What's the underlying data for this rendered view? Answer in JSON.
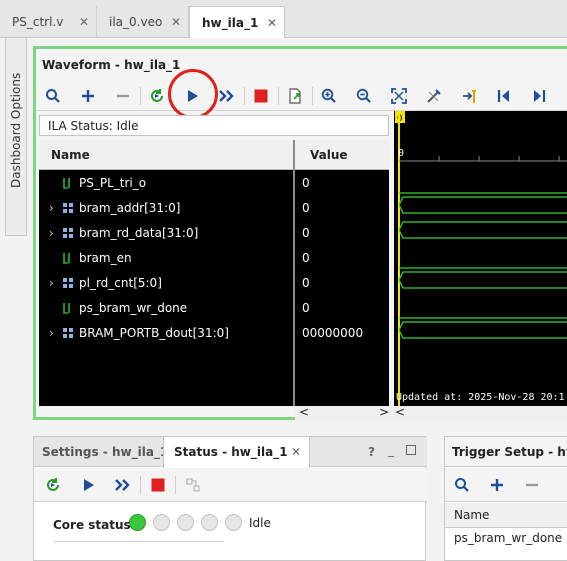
{
  "tabs": [
    {
      "label": "PS_ctrl.v",
      "active": false
    },
    {
      "label": "ila_0.veo",
      "active": false
    },
    {
      "label": "hw_ila_1",
      "active": true
    }
  ],
  "side_label": "Dashboard Options",
  "waveform": {
    "title": "Waveform - hw_ila_1",
    "ila_status": "ILA Status:  Idle",
    "col_name": "Name",
    "col_value": "Value",
    "signals": [
      {
        "name": "PS_PL_tri_o",
        "value": "0",
        "expandable": false,
        "bus": false
      },
      {
        "name": "bram_addr[31:0]",
        "value": "0",
        "expandable": true,
        "bus": true
      },
      {
        "name": "bram_rd_data[31:0]",
        "value": "0",
        "expandable": true,
        "bus": true
      },
      {
        "name": "bram_en",
        "value": "0",
        "expandable": false,
        "bus": false
      },
      {
        "name": "pl_rd_cnt[5:0]",
        "value": "0",
        "expandable": true,
        "bus": true
      },
      {
        "name": "ps_bram_wr_done",
        "value": "0",
        "expandable": false,
        "bus": false
      },
      {
        "name": "BRAM_PORTB_dout[31:0]",
        "value": "00000000",
        "expandable": true,
        "bus": true
      }
    ],
    "marker_label": "0",
    "axis_label": "0",
    "updated_text": "Updated at: 2025-Nov-28 20:1",
    "scroll_left": "<",
    "scroll_right": ">"
  },
  "settings_panel": {
    "tabs": [
      {
        "label": "Settings - hw_ila_1",
        "active": false
      },
      {
        "label": "Status - hw_ila_1",
        "active": true
      }
    ],
    "help": "?",
    "core_status_label": "Core status",
    "core_status_value": "Idle",
    "lamps": [
      "green",
      "gray",
      "gray",
      "gray",
      "gray"
    ]
  },
  "trigger_panel": {
    "title": "Trigger Setup - hw_il",
    "col_name": "Name",
    "row": "ps_bram_wr_done"
  },
  "colors": {
    "highlight_border": "#7ed67e",
    "annotation_circle": "#e0201a",
    "run_blue": "#1f4e99",
    "stop_red": "#e02020",
    "wave_green": "#36d236",
    "marker_yellow": "#f2e600",
    "lamp_green": "#3cc63c"
  }
}
